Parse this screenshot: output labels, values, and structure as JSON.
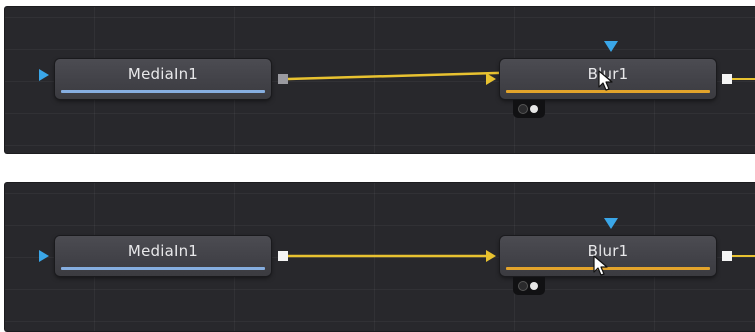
{
  "panels": [
    {
      "nodes": {
        "media_in": {
          "label": "MediaIn1"
        },
        "blur": {
          "label": "Blur1"
        }
      }
    },
    {
      "nodes": {
        "media_in": {
          "label": "MediaIn1"
        },
        "blur": {
          "label": "Blur1"
        }
      }
    }
  ],
  "colors": {
    "panel_bg": "#28282c",
    "mediain_bar": "#86aee0",
    "blur_bar": "#e3a42b",
    "wire": "#e8c230",
    "input_triangle_blue": "#3aa6e8"
  },
  "icons": [
    "input-triangle-icon",
    "output-square-icon",
    "effect-mask-triangle-icon",
    "mouse-pointer-icon"
  ]
}
